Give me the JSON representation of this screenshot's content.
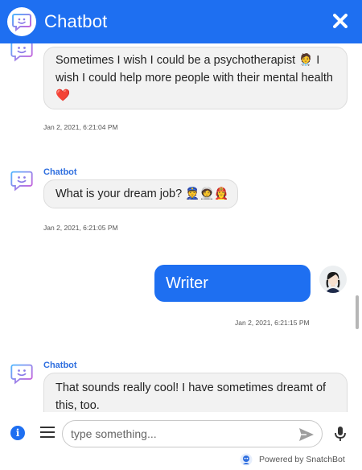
{
  "header": {
    "title": "Chatbot",
    "logo_icon": "chat-smile-icon",
    "close_icon": "close-icon",
    "color": "#1e6ff1"
  },
  "messages": [
    {
      "from": "bot",
      "sender": "",
      "text": "Sometimes I wish I could be a psychotherapist 🧑‍⚕️ I wish I could help more people with their mental health ❤️",
      "timestamp": "Jan 2, 2021, 6:21:04 PM"
    },
    {
      "from": "bot",
      "sender": "Chatbot",
      "text": "What is your dream job? 👮🧑‍🚀👩‍🚒",
      "timestamp": "Jan 2, 2021, 6:21:05 PM"
    },
    {
      "from": "user",
      "text": "Writer",
      "timestamp": "Jan 2, 2021, 6:21:15 PM"
    },
    {
      "from": "bot",
      "sender": "Chatbot",
      "text": "That sounds really cool! I have sometimes dreamt of this, too.",
      "timestamp": ""
    }
  ],
  "composer": {
    "placeholder": "type something...",
    "info_icon": "info-icon",
    "menu_icon": "menu-icon",
    "send_icon": "send-icon",
    "mic_icon": "mic-icon"
  },
  "footer": {
    "powered_by": "Powered by SnatchBot"
  }
}
